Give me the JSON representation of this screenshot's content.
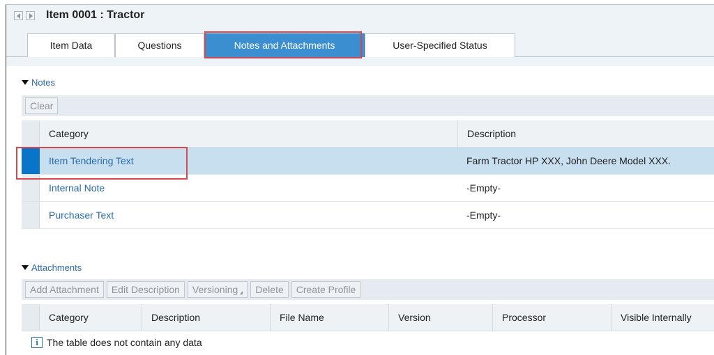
{
  "header": {
    "title": "Item 0001 : Tractor"
  },
  "tabs": [
    {
      "label": "Item Data"
    },
    {
      "label": "Questions"
    },
    {
      "label": "Notes and Attachments",
      "active": true
    },
    {
      "label": "User-Specified Status"
    }
  ],
  "notes": {
    "section_label": "Notes",
    "toolbar": {
      "clear_label": "Clear"
    },
    "columns": {
      "category": "Category",
      "description": "Description"
    },
    "rows": [
      {
        "category": "Item Tendering Text",
        "description": "Farm Tractor HP XXX, John Deere Model XXX.",
        "selected": true
      },
      {
        "category": "Internal Note",
        "description": "-Empty-"
      },
      {
        "category": "Purchaser Text",
        "description": "-Empty-"
      }
    ]
  },
  "attachments": {
    "section_label": "Attachments",
    "toolbar": {
      "add_attachment": "Add Attachment",
      "edit_description": "Edit Description",
      "versioning": "Versioning",
      "delete": "Delete",
      "create_profile": "Create Profile"
    },
    "columns": {
      "category": "Category",
      "description": "Description",
      "file_name": "File Name",
      "version": "Version",
      "processor": "Processor",
      "visible_internally": "Visible Internally"
    },
    "empty_message": "The table does not contain any data"
  },
  "colors": {
    "accent": "#3b8ed0",
    "selection": "#0a74c9",
    "highlight": "#d9464e",
    "link": "#2a6aa8"
  }
}
